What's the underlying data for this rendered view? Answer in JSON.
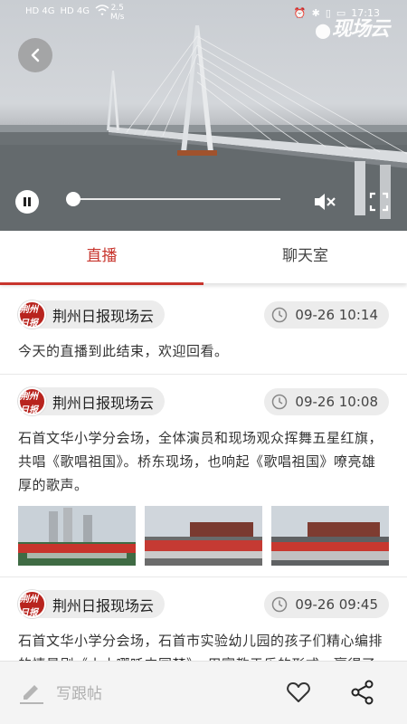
{
  "status_bar": {
    "signal_1": "HD 4G",
    "signal_2": "HD 4G",
    "speed_value": "2.5",
    "speed_unit": "M/s",
    "time": "17:13"
  },
  "video": {
    "brand": "现场云",
    "progress": 0.0
  },
  "tabs": [
    {
      "label": "直播",
      "active": true
    },
    {
      "label": "聊天室",
      "active": false
    }
  ],
  "posts": [
    {
      "author": "荆州日报现场云",
      "avatar_text": "荆州日报",
      "time": "09-26 10:14",
      "text": "今天的直播到此结束，欢迎回看。",
      "photos": 0
    },
    {
      "author": "荆州日报现场云",
      "avatar_text": "荆州日报",
      "time": "09-26 10:08",
      "text": "石首文华小学分会场，全体演员和现场观众挥舞五星红旗，共唱《歌唱祖国》。桥东现场，也响起《歌唱祖国》嘹亮雄厚的歌声。",
      "photos": 3
    },
    {
      "author": "荆州日报现场云",
      "avatar_text": "荆州日报",
      "time": "09-26 09:45",
      "text": "石首文华小学分会场，石首市实验幼儿园的孩子们精心编排的情景剧《小小哪吒中国梦》，用寓教于乐的形式，赢得了",
      "photos": 0
    }
  ],
  "bottom_bar": {
    "write_label": "写跟帖"
  },
  "colors": {
    "accent": "#c8352d",
    "chip_bg": "#ececec"
  }
}
